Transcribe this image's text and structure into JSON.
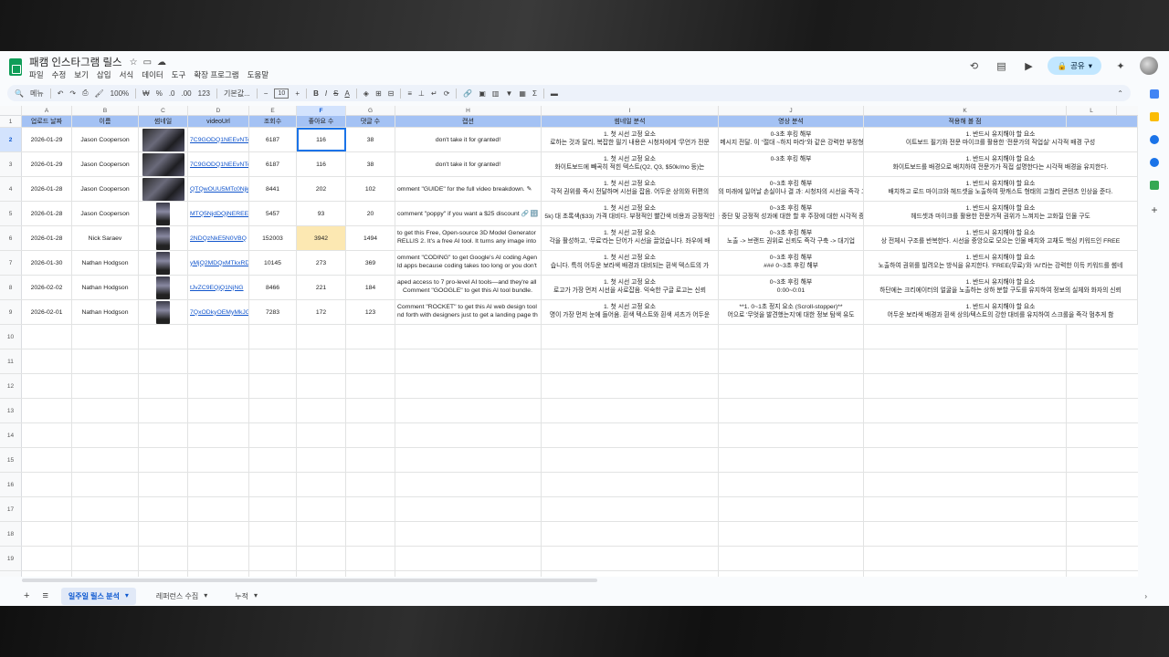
{
  "app": {
    "doc_title": "패캠 인스타그램 릴스",
    "menu": [
      "파일",
      "수정",
      "보기",
      "삽입",
      "서식",
      "데이터",
      "도구",
      "확장 프로그램",
      "도움말"
    ],
    "share_label": "공유"
  },
  "toolbar": {
    "menu_search": "메뉴",
    "zoom": "100%",
    "currency": "₩",
    "percent": "%",
    "dec_down": ".0",
    "dec_up": ".00",
    "number_format": "123",
    "font": "기본값...",
    "font_size": "10"
  },
  "columns": [
    "A",
    "B",
    "C",
    "D",
    "E",
    "F",
    "G",
    "H",
    "I",
    "J",
    "K",
    "L"
  ],
  "header": [
    "업로드 날짜",
    "이름",
    "썸네일",
    "videoUrl",
    "조회수",
    "좋아요 수",
    "댓글 수",
    "캡션",
    "썸네일 분석",
    "영상 분석",
    "적용해 볼 점",
    ""
  ],
  "rows": [
    {
      "num": "2",
      "date": "2026-01-29",
      "name": "Jason Cooperson",
      "url": "7C9GODQ1NEEvNTc",
      "views": "6187",
      "likes": "116",
      "comments": "38",
      "caption": "don't take it for granted!",
      "thumb_t": "1. 첫 시선 고정 요소",
      "thumb_b": "로하는 것과 달리, 복잡한 필기 내용은 시청자에게 '무언가 전문",
      "vid_t": "0-3초 후킹 해부",
      "vid_b": "크롤을 멈추게 하는 강력한 경고 메시지 전달. 이 \"절대 ~하지 마라\"와 같은 강력한 부정형 문장으로 시작하는 오프닝 방식",
      "app_t": "1. 반드시 유지해야 할 요소",
      "app_b": "이트보드 필기와 전문 마이크를 활용한 '전문가의 작업실' 시각적 배경 구성"
    },
    {
      "num": "3",
      "date": "2026-01-29",
      "name": "Jason Cooperson",
      "url": "7C9GODQ1NEEvNTc",
      "views": "6187",
      "likes": "116",
      "comments": "38",
      "caption": "don't take it for granted!",
      "thumb_t": "1. 첫 시선 고정 요소",
      "thumb_b": "화이트보드에 빼곡히 적힌 텍스트(Q2, Q3, $50k/mo 등)는",
      "vid_t": "0-3초 후킹 해부",
      "vid_b": "",
      "app_t": "1. 반드시 유지해야 할 요소",
      "app_b": "화이트보드를 배경으로 배치하여 전문가가 직접 설명한다는 시각적 배경을 유지한다."
    },
    {
      "num": "4",
      "date": "2026-01-28",
      "name": "Jason Cooperson",
      "url": "QTQwOUU5MTc0Njk",
      "views": "8441",
      "likes": "202",
      "comments": "102",
      "caption": "omment \"GUIDE\" for the full video breakdown. ✎",
      "thumb_t": "1. 첫 시선 고정 요소",
      "thumb_b": "각적 권위를 즉시 전달하며 시선을 잡음. 어두운 상의와 뒤편의",
      "vid_t": "0~3초 후킹 해부",
      "vid_b": "제시 -> 효과: 시청자의 미래에 일어날 손실이나 결 과: 시청자의 시선을 즉각 고정시키고 전문가 조",
      "app_t": "1. 반드시 유지해야 할 요소",
      "app_b": "배치하고 로드 마이크와 헤드셋을 노출하여 팟캐스트 형태의 고퀄리 콘텐츠 인상을 준다."
    },
    {
      "num": "5",
      "date": "2026-01-28",
      "name": "Jason Cooperson",
      "url": "MTQ5NjdDQjNEREE",
      "views": "5457",
      "likes": "93",
      "comments": "20",
      "caption": "comment \"poppy\" if you want a $25 discount 🔗 🔢",
      "thumb_t": "1. 첫 시선 고정 요소",
      "thumb_b": "5k) 대 초록색($33) 가격 대비다. 부정적인 빨간색 비용과 긍정적인",
      "vid_t": "0~3초 후킹 해부",
      "vid_b": "말함 -> 효과: 스크롤 중단 및 긍정적 성과에 대한 할 후 주장에 대한 시각적 증거 기대감 형성 -> 0",
      "app_t": "1. 반드시 유지해야 할 요소",
      "app_b": "헤드셋과 마이크를 활용한 전문가적 권위가 느껴지는 고화질 인물 구도"
    },
    {
      "num": "6",
      "date": "2026-01-28",
      "name": "Nick Saraev",
      "url": "2NDQzNkE5N0VBQ",
      "views": "152003",
      "likes": "3942",
      "comments": "1494",
      "caption": "to get this Free, Open-source 3D Model Generator",
      "thumb_t": "1. 첫 시선 고정 요소",
      "thumb_b": "각을 활성하고, '무료'라는 단어가 시선을 끌었습니다. 좌우에 배",
      "vid_t": "0~3초 후킹 해부",
      "vid_b": "노출 -> 브랜드 권위로 신뢰도 즉각 구축 -> 대기업",
      "app_t": "1. 반드시 유지해야 할 요소",
      "app_b": "상 전체시 구조를 반복한다. 시선을 중앙으로 모으는 인물 배치와 고채도 핵심 키워드인 FREE"
    },
    {
      "num": "7",
      "date": "2026-01-30",
      "name": "Nathan Hodgson",
      "url": "yMjQ2MDQxMTkxRD",
      "views": "10145",
      "likes": "273",
      "comments": "369",
      "caption": "omment \"CODING\" to get Google's AI coding Agen",
      "thumb_t": "1. 첫 시선 고정 요소",
      "thumb_b": "습니다. 특히 어두운 보라색 배경과 대비되는 흰색 텍스트의 가",
      "vid_t": "0~3초 후킹 해부",
      "vid_b": "",
      "app_t": "1. 반드시 유지해야 할 요소",
      "app_b": "노출하여 권위를 빌려오는 방식을 유지한다. 'FREE(무료)'와 'AI'라는 강력한 이득 키워드를 썸네"
    },
    {
      "num": "8",
      "date": "2026-02-02",
      "name": "Nathan Hodgson",
      "url": "tJvZC9EQjQ1NjNG",
      "views": "8466",
      "likes": "221",
      "comments": "184",
      "caption": "Comment \"GOOGLE\" to get this AI tool bundle.",
      "thumb_t": "1. 첫 시선 고정 요소",
      "thumb_b": "로고가 가장 먼저 시선을 사로잡음. 익숙한 구글 로고는 신뢰",
      "vid_t": "0~3초 후킹 해부",
      "vid_b": "0:00~0:01",
      "app_t": "1. 반드시 유지해야 할 요소",
      "app_b": "하단에는 크리에이터의 얼굴을 노출하는 상하 분할 구도를 유지하여 정보의 실체와 화자의 신뢰"
    },
    {
      "num": "9",
      "date": "2026-02-01",
      "name": "Nathan Hodgson",
      "url": "7QxODkyOEMyMkJG",
      "views": "7283",
      "likes": "172",
      "comments": "123",
      "caption": "nd forth with designers just to get a landing page th",
      "thumb_t": "1. 첫 시선 고정 요소",
      "thumb_b": "명이 가장 먼저 눈에 들어옴. 흰색 텍스트와 흰색 셔츠가 어두운",
      "vid_t": "**1. 0~1초 정지 요소 (Scroll-stopper)**",
      "vid_b": "어으로 '무엇을 발견했는지'에 대한 정보 탐색 유도",
      "app_t": "1. 반드시 유지해야 할 요소",
      "app_b": "어두운 보라색 배경과 흰색 상의/텍스트의 강한 대비를 유지하여 스크롤을 즉각 멈추게 함"
    }
  ],
  "extra_lines": {
    "r6_caption2": "RELLIS 2. It's a free AI tool. It turns any image into",
    "r7_caption2": "ld apps because coding takes too long or you don't",
    "r8_caption2": "aped access to 7 pro-level AI tools—and they're all",
    "r9_caption2": "Comment \"ROCKET\" to get this AI web design tool",
    "r7_vid2": "하는 구글(G) 로고 애니메이션, 하단에는 화자의 얼",
    "r7_vid3": "### 0~3초 후킹 해부",
    "r5_app2": "상 안에 구체적인 수치 성과($1,000)를 육성으로 즉시 선언하는 오프닝 방식을 반복한다.",
    "r4_app2": "의 보편적 방식을 \"Trash\"라고 규정하며 인지 부조화를 일으키는 부정적 후킹",
    "r6_app2": "크리에이터의 얼굴을 노출하는 화자의 신뢰",
    "r8_app2": "하는 거대 테크 기업의 로고를 영상 시작 2초 이내에 배치하여 시청자가 스크롤을 멈출 명분을 제",
    "r9_app2": "적 1초 안에 완성된 고퀄리티 웹사이트 결과물을 3~4개 연달아 노출해 시각적 보상을 먼저 제공"
  },
  "empty_rows": [
    "10",
    "11",
    "12",
    "13",
    "14",
    "15",
    "16",
    "17",
    "18",
    "19",
    "20"
  ],
  "sheets": [
    "일주일 릴스 분석",
    "레퍼런스 수집",
    "누적"
  ],
  "colors": {
    "header_fill": "#a4c2f4",
    "highlight": "#fce8b2",
    "accent": "#1a73e8"
  }
}
